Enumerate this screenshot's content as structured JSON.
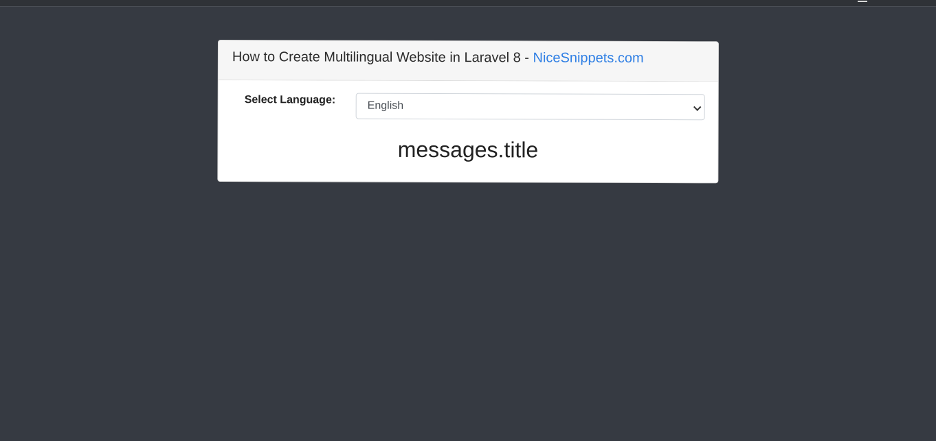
{
  "header": {
    "title_prefix": "How to Create Multilingual Website in Laravel 8 - ",
    "link_text": "NiceSnippets.com"
  },
  "form": {
    "label": "Select Language:",
    "select_value": "English"
  },
  "content": {
    "message": "messages.title"
  },
  "colors": {
    "background": "#363a42",
    "link": "#2f7fe4"
  }
}
